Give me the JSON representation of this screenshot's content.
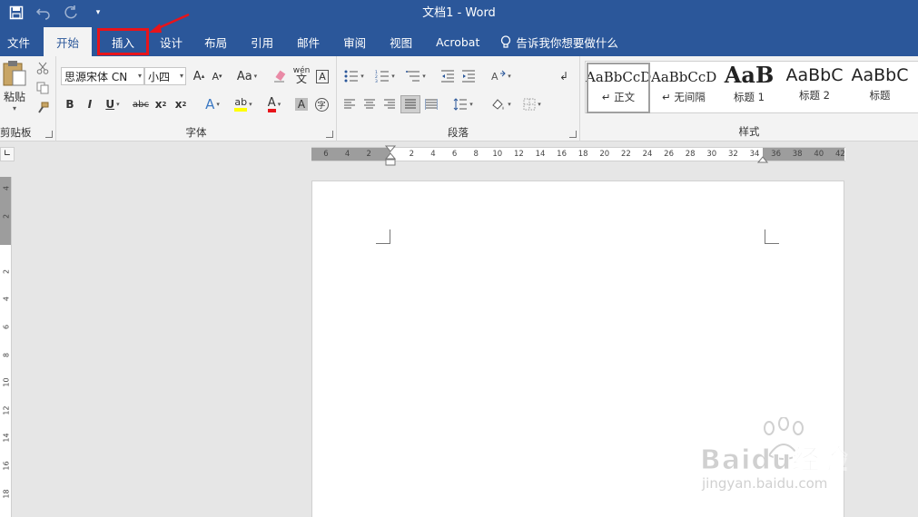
{
  "window": {
    "title": "文档1  -  Word"
  },
  "qat": {
    "save_icon": "save-icon",
    "undo_icon": "undo-icon",
    "redo_icon": "redo-icon",
    "customize_icon": "customize-qat-icon"
  },
  "tabs": [
    {
      "label": "文件"
    },
    {
      "label": "开始"
    },
    {
      "label": "插入"
    },
    {
      "label": "设计"
    },
    {
      "label": "布局"
    },
    {
      "label": "引用"
    },
    {
      "label": "邮件"
    },
    {
      "label": "审阅"
    },
    {
      "label": "视图"
    },
    {
      "label": "Acrobat"
    }
  ],
  "tell_me": {
    "text": "告诉我你想要做什么"
  },
  "ribbon": {
    "clipboard": {
      "label": "剪贴板",
      "paste_label": "粘贴"
    },
    "font": {
      "label": "字体",
      "font_name": "思源宋体 CN",
      "font_size": "小四"
    },
    "paragraph": {
      "label": "段落"
    },
    "styles": {
      "label": "样式",
      "items": [
        {
          "sample": "AaBbCcDd",
          "name": "↵ 正文"
        },
        {
          "sample": "AaBbCcDd",
          "name": "↵ 无间隔"
        },
        {
          "sample": "AaB",
          "name": "标题 1"
        },
        {
          "sample": "AaBbC",
          "name": "标题 2"
        },
        {
          "sample": "AaBbC",
          "name": "标题"
        }
      ]
    }
  },
  "ruler": {
    "h_ticks": [
      "6",
      "4",
      "2",
      "",
      "2",
      "4",
      "6",
      "8",
      "10",
      "12",
      "14",
      "16",
      "18",
      "20",
      "22",
      "24",
      "26",
      "28",
      "30",
      "32",
      "34",
      "36",
      "38",
      "40",
      "42"
    ],
    "v_ticks": [
      "4",
      "2",
      "",
      "2",
      "4",
      "6",
      "8",
      "10",
      "12",
      "14",
      "16",
      "18"
    ]
  },
  "watermark": {
    "brand": "Baidu经验",
    "url": "jingyan.baidu.com"
  },
  "colors": {
    "accent": "#2b579a",
    "highlight": "#e8141a"
  }
}
